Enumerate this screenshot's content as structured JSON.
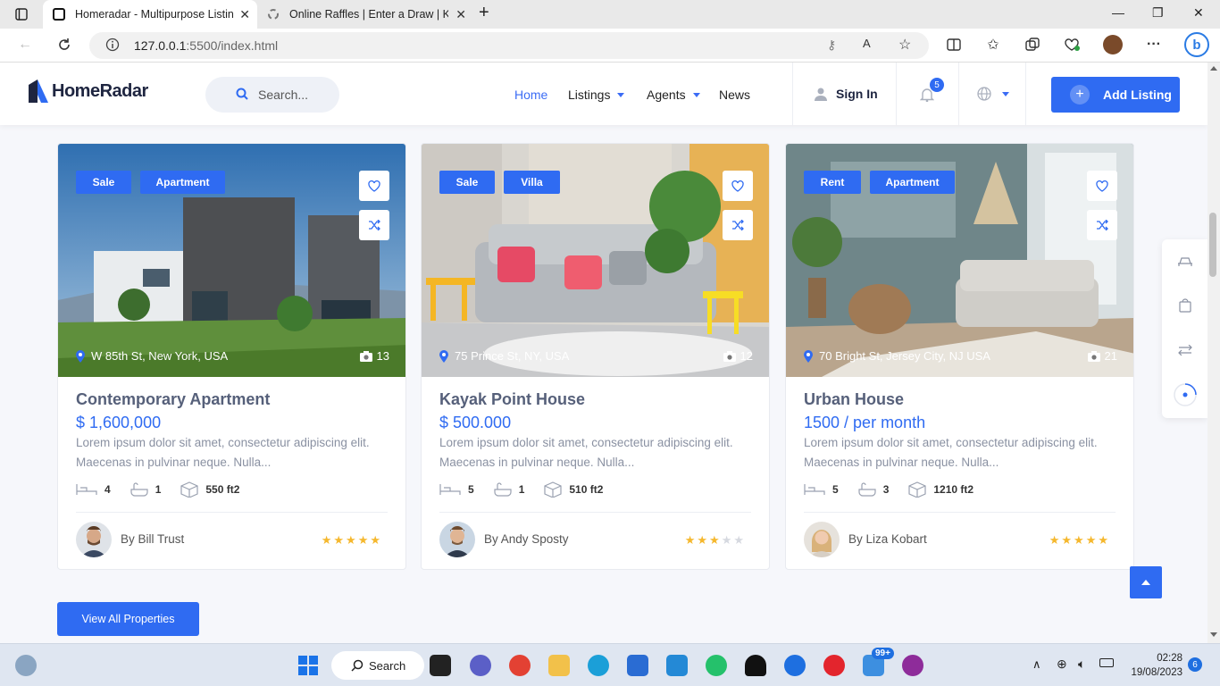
{
  "browser": {
    "tabs": [
      {
        "title": "Homeradar - Multipurpose Listin"
      },
      {
        "title": "Online Raffles | Enter a Draw | Ko"
      }
    ],
    "url_host": "127.0.0.1",
    "url_path": ":5500/index.html"
  },
  "header": {
    "logo_text": "HomeRadar",
    "search_placeholder": "Search...",
    "nav": [
      "Home",
      "Listings",
      "Agents",
      "News"
    ],
    "sign_in": "Sign In",
    "notification_count": "5",
    "add_listing": "Add Listing"
  },
  "properties": [
    {
      "tags": [
        "Sale",
        "Apartment"
      ],
      "location": "W 85th St, New York, USA",
      "photos": "13",
      "title": "Contemporary Apartment",
      "price": "$ 1,600,000",
      "description": "Lorem ipsum dolor sit amet, consectetur adipiscing elit. Maecenas in pulvinar neque. Nulla...",
      "beds": "4",
      "baths": "1",
      "area": "550 ft2",
      "agent": "By Bill Trust",
      "rating": 5
    },
    {
      "tags": [
        "Sale",
        "Villa"
      ],
      "location": "75 Prince St, NY, USA",
      "photos": "12",
      "title": "Kayak Point House",
      "price": "$ 500.000",
      "description": "Lorem ipsum dolor sit amet, consectetur adipiscing elit. Maecenas in pulvinar neque. Nulla...",
      "beds": "5",
      "baths": "1",
      "area": "510 ft2",
      "agent": "By Andy Sposty",
      "rating": 3
    },
    {
      "tags": [
        "Rent",
        "Apartment"
      ],
      "location": "70 Bright St, Jersey City, NJ USA",
      "photos": "21",
      "title": "Urban House",
      "price": "1500 / per month",
      "description": "Lorem ipsum dolor sit amet, consectetur adipiscing elit. Maecenas in pulvinar neque. Nulla...",
      "beds": "5",
      "baths": "3",
      "area": "1210 ft2",
      "agent": "By Liza Kobart",
      "rating": 5
    }
  ],
  "view_all": "View All Properties",
  "taskbar": {
    "search": "Search",
    "badge_count": "99+",
    "time": "02:28",
    "date": "19/08/2023",
    "notifications": "6"
  },
  "colors": {
    "accent": "#2f6bf2",
    "star": "#f5b82e",
    "star_off": "#d6d9e0"
  }
}
